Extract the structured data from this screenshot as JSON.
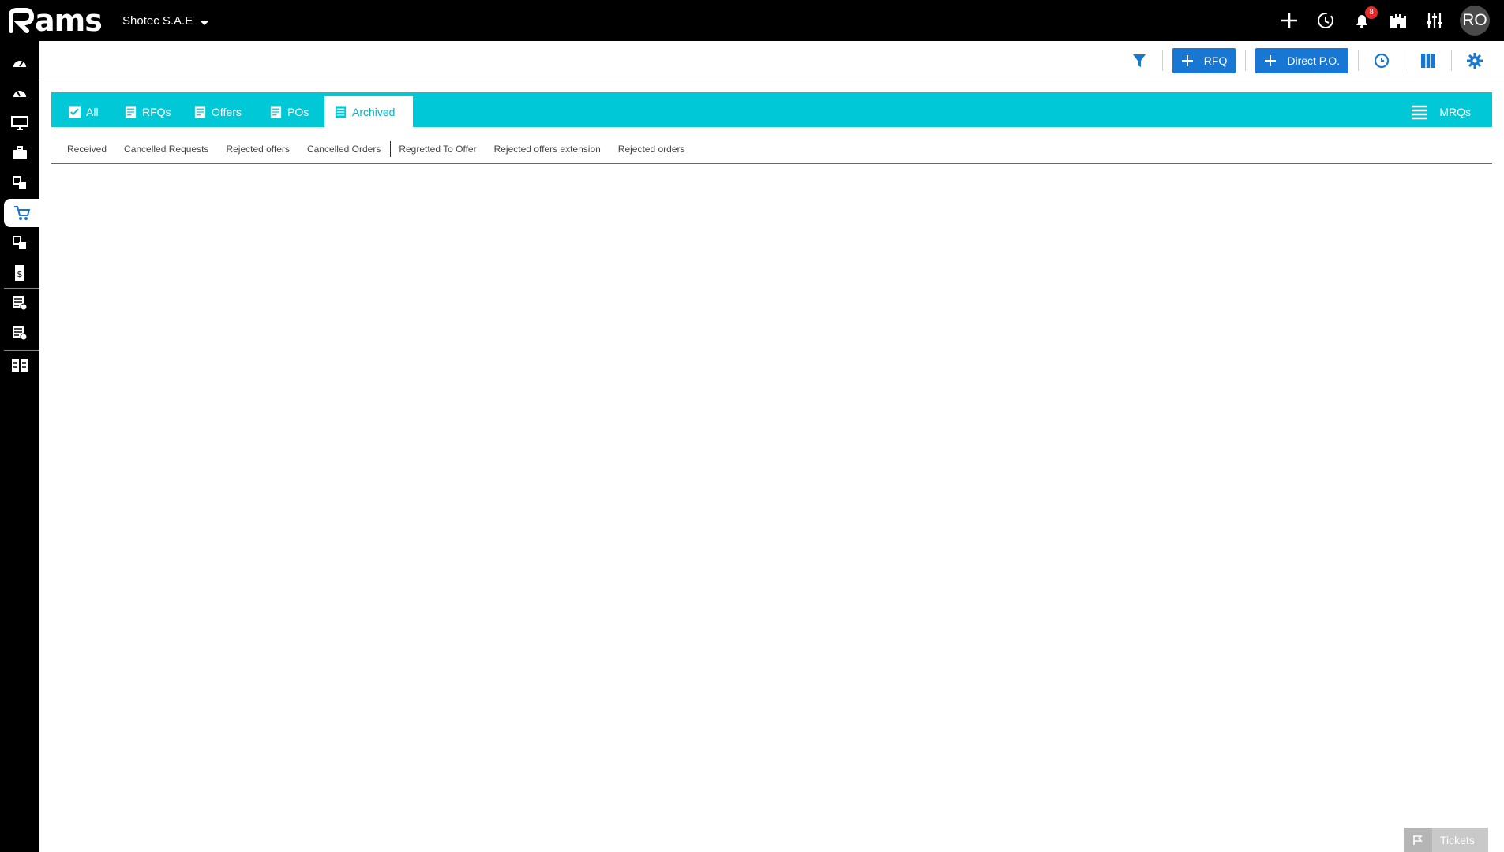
{
  "header": {
    "logo_text": "ams",
    "company": "Shotec S.A.E",
    "notification_count": "8",
    "avatar_initials": "RO",
    "icons": [
      "add-icon",
      "history-icon",
      "bell-icon",
      "castle-icon",
      "sliders-icon"
    ]
  },
  "sidebar": {
    "items": [
      {
        "icon": "dashboard-icon"
      },
      {
        "icon": "dashboard-alt-icon"
      },
      {
        "icon": "monitor-icon"
      },
      {
        "icon": "briefcase-icon"
      },
      {
        "icon": "layers-icon"
      },
      {
        "icon": "cart-icon",
        "active": true
      },
      {
        "icon": "layers-alt-icon"
      },
      {
        "icon": "invoice-icon"
      },
      {
        "icon": "checklist-icon"
      },
      {
        "icon": "rejected-list-icon"
      },
      {
        "icon": "grid-icon"
      }
    ]
  },
  "toolbar": {
    "rfq_label": "RFQ",
    "direct_po_label": "Direct P.O."
  },
  "tabs": {
    "items": [
      {
        "label": "All"
      },
      {
        "label": "RFQs"
      },
      {
        "label": "Offers"
      },
      {
        "label": "POs"
      },
      {
        "label": "Archived",
        "active": true
      }
    ],
    "mrqs_label": "MRQs"
  },
  "subtabs": {
    "items": [
      "Received",
      "Cancelled Requests",
      "Rejected offers",
      "Cancelled Orders",
      "Regretted To Offer",
      "Rejected offers extension",
      "Rejected orders"
    ]
  },
  "footer": {
    "tickets_label": "Tickets"
  },
  "colors": {
    "accent": "#1877d2",
    "tab_bar": "#00c8d7",
    "badge": "#e32a2a",
    "chrome": "#000000"
  }
}
